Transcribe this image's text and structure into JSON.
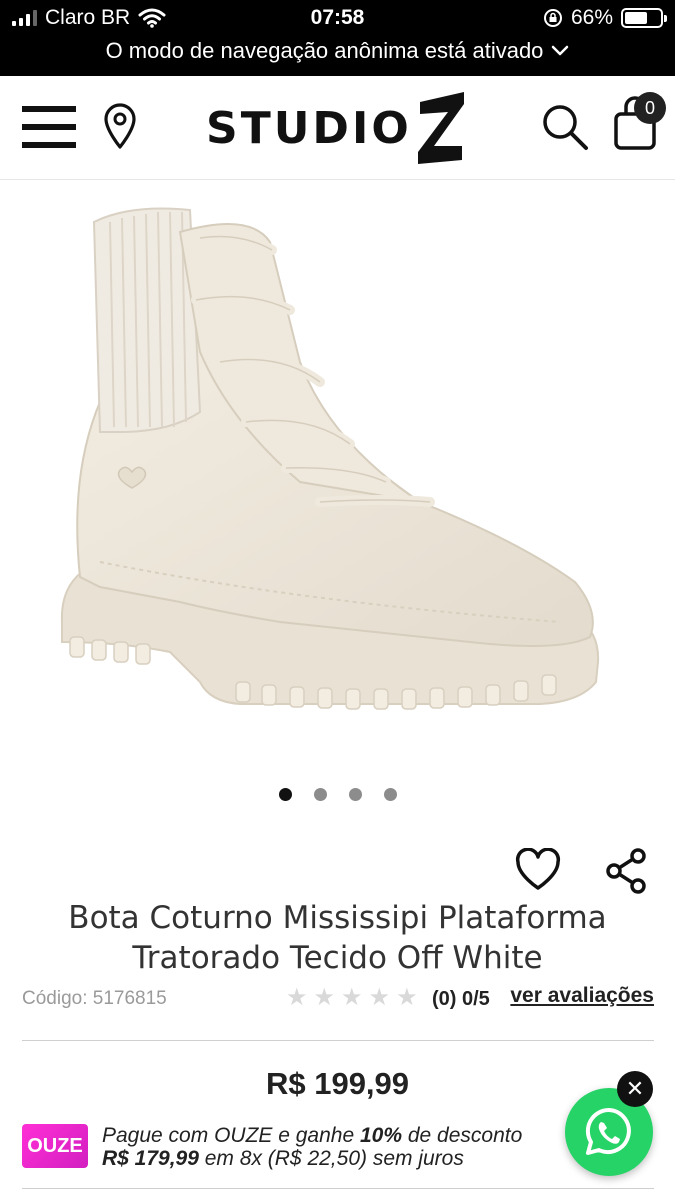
{
  "status_bar": {
    "carrier": "Claro BR",
    "time": "07:58",
    "battery_percent": "66%",
    "battery_level": 0.66,
    "incognito_notice": "O modo de navegação anônima está ativado"
  },
  "header": {
    "logo_text": "STUDIO",
    "cart_count": "0"
  },
  "gallery": {
    "image_count": 4,
    "active_index": 0
  },
  "product": {
    "title": "Bota Coturno Mississipi Plataforma Tratorado Tecido Off White",
    "code": "Código: 5176815",
    "stars": 5,
    "rating_count": "(0) 0/5",
    "reviews_link": "ver avaliações",
    "price": "R$ 199,99"
  },
  "ouze": {
    "logo": "OUZE",
    "line1_pre": "Pague com OUZE e ganhe ",
    "line1_bold": "10%",
    "line1_post": " de desconto",
    "line2_bold": "R$ 179,99",
    "line2_post": " em 8x (R$ 22,50) sem juros"
  },
  "colors": {
    "accent_whatsapp": "#25d366",
    "ouze_pink": "#ff2fd6",
    "boot_color": "#ece5d8"
  }
}
